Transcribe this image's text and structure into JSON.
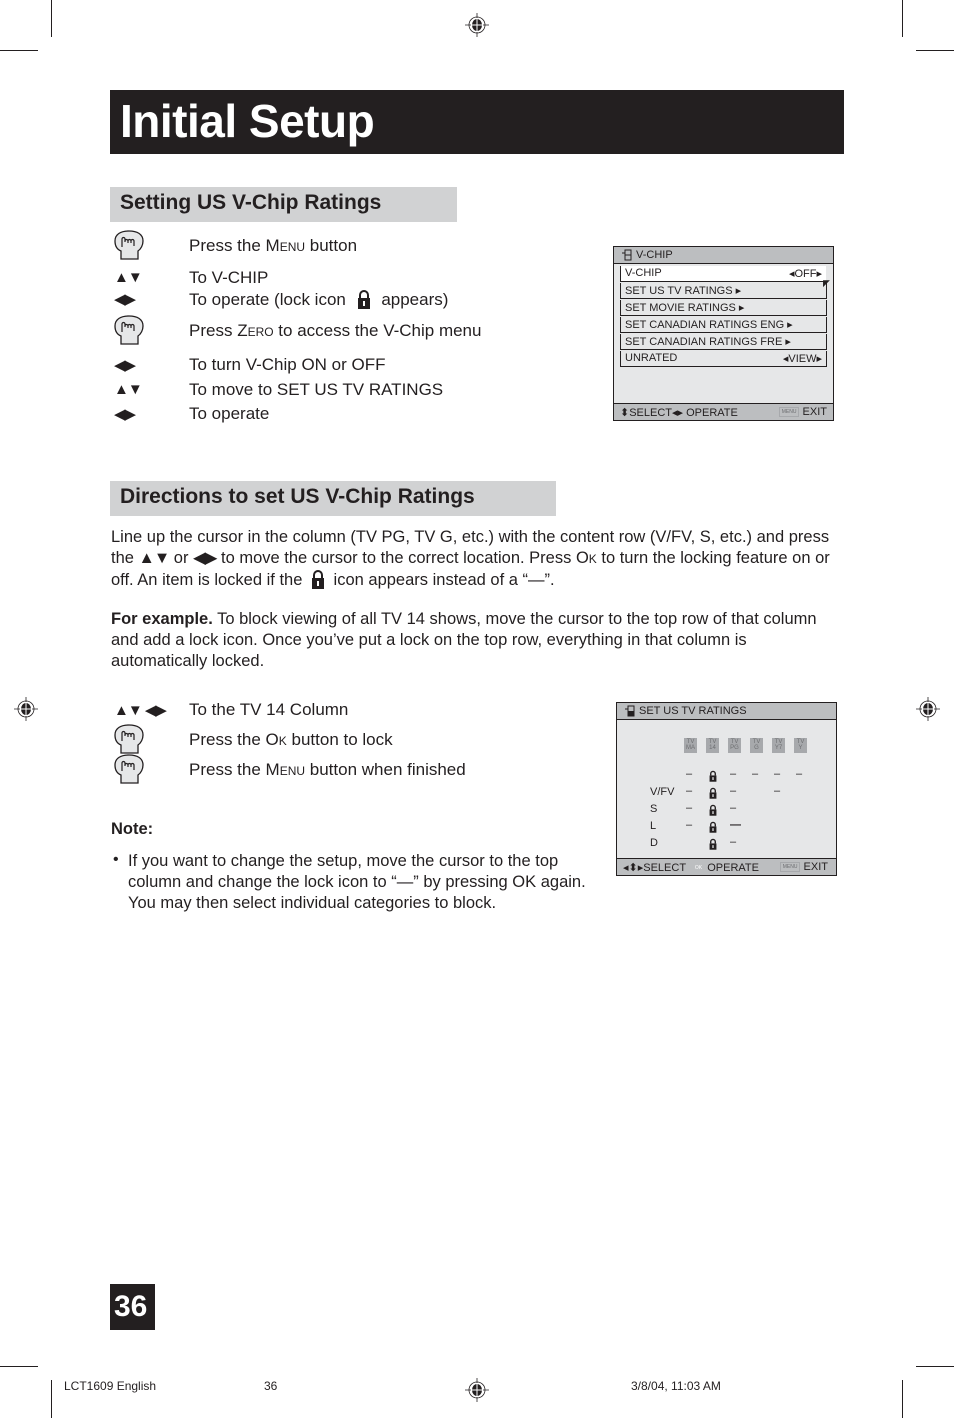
{
  "page_title": "Initial Setup",
  "section1": {
    "heading": "Setting US V-Chip Ratings",
    "steps": [
      {
        "icon": "hand-press-icon",
        "pre": "Press the ",
        "sc": "Menu",
        "post": " button"
      },
      {
        "icon": "up-down-arrows-icon",
        "text": "To V-CHIP"
      },
      {
        "icon": "left-right-arrows-icon",
        "pre": "To operate (lock icon ",
        "post": " appears)"
      },
      {
        "icon": "hand-press-icon",
        "pre": "Press ",
        "sc": "Zero",
        "post": " to access the V-Chip menu"
      },
      {
        "icon": "left-right-arrows-icon",
        "text": "To turn V-Chip ON or OFF"
      },
      {
        "icon": "up-down-arrows-icon",
        "text": "To move to SET US TV RATINGS"
      },
      {
        "icon": "left-right-arrows-icon",
        "text": "To operate"
      }
    ]
  },
  "vchip_menu": {
    "title": "V-CHIP",
    "items": [
      {
        "label": "V-CHIP",
        "value": "◂OFF▸",
        "selected": true
      },
      {
        "label": "SET US TV RATINGS ▸",
        "value": ""
      },
      {
        "label": "SET MOVIE RATINGS ▸",
        "value": ""
      },
      {
        "label": "SET CANADIAN RATINGS ENG ▸",
        "value": ""
      },
      {
        "label": "SET CANADIAN RATINGS FRE ▸",
        "value": ""
      },
      {
        "label": "UNRATED",
        "value": "◂VIEW▸"
      }
    ],
    "footer_select": "⬍SELECT◂▸ OPERATE",
    "footer_menu_chip": "MENU",
    "footer_exit": "EXIT"
  },
  "section2": {
    "heading": "Directions to set US V-Chip Ratings",
    "para1_a": "Line up the cursor in the column (TV PG, TV G, etc.) with the content row (V/FV, S, etc.) and press the ",
    "para1_arrows_ud": "▲▼",
    "para1_or": " or ",
    "para1_arrows_lr": "◀▶",
    "para1_b": " to move the cursor to the correct location. Press ",
    "para1_ok": "Ok",
    "para1_c": " to turn the locking feature on or off. An item is locked if the ",
    "para1_d": " icon appears instead of a “—”.",
    "para2_bold": "For example.",
    "para2_text": " To block viewing of all TV 14 shows, move the cursor to the top row of that column and add a lock icon. Once you’ve put a lock on the top row, everything in that column is automatically locked.",
    "steps": [
      {
        "icon": "arrows-all-icon",
        "text": "To the TV 14 Column"
      },
      {
        "icon": "hand-press-icon",
        "pre": "Press the ",
        "sc": "Ok",
        "post": " button to lock"
      },
      {
        "icon": "hand-press-icon",
        "pre": "Press the ",
        "sc": "Menu",
        "post": " button when finished"
      }
    ],
    "note_heading": "Note:",
    "note_bullet": "•",
    "note_text": "If you want to change the setup, move the cursor to the top column and change the lock icon to “—” by pressing OK again. You may then select individual categories to block."
  },
  "ratings_menu": {
    "title": "SET US TV RATINGS",
    "columns": [
      {
        "top": "TV",
        "bottom": "MA"
      },
      {
        "top": "TV",
        "bottom": "14"
      },
      {
        "top": "TV",
        "bottom": "PG"
      },
      {
        "top": "TV",
        "bottom": "G"
      },
      {
        "top": "TV",
        "bottom": "Y7"
      },
      {
        "top": "TV",
        "bottom": "Y"
      }
    ],
    "rows": [
      {
        "label": "",
        "cells": [
          "–",
          "lock",
          "–",
          "–",
          "–",
          "–"
        ]
      },
      {
        "label": "V/FV",
        "cells": [
          "–",
          "lock",
          "–",
          "",
          "–",
          ""
        ]
      },
      {
        "label": "S",
        "cells": [
          "–",
          "lock",
          "–",
          "",
          "",
          ""
        ]
      },
      {
        "label": "L",
        "cells": [
          "–",
          "lock",
          "—",
          "",
          "",
          ""
        ]
      },
      {
        "label": "D",
        "cells": [
          "",
          "lock",
          "–",
          "",
          "",
          ""
        ]
      }
    ],
    "footer_select": "◂⬍▸SELECT",
    "footer_ok_chip": "OK",
    "footer_operate": "OPERATE",
    "footer_menu_chip": "MENU",
    "footer_exit": "EXIT"
  },
  "page_number": "36",
  "slug": {
    "file": "LCT1609 English",
    "page": "36",
    "datetime": "3/8/04, 11:03 AM"
  }
}
